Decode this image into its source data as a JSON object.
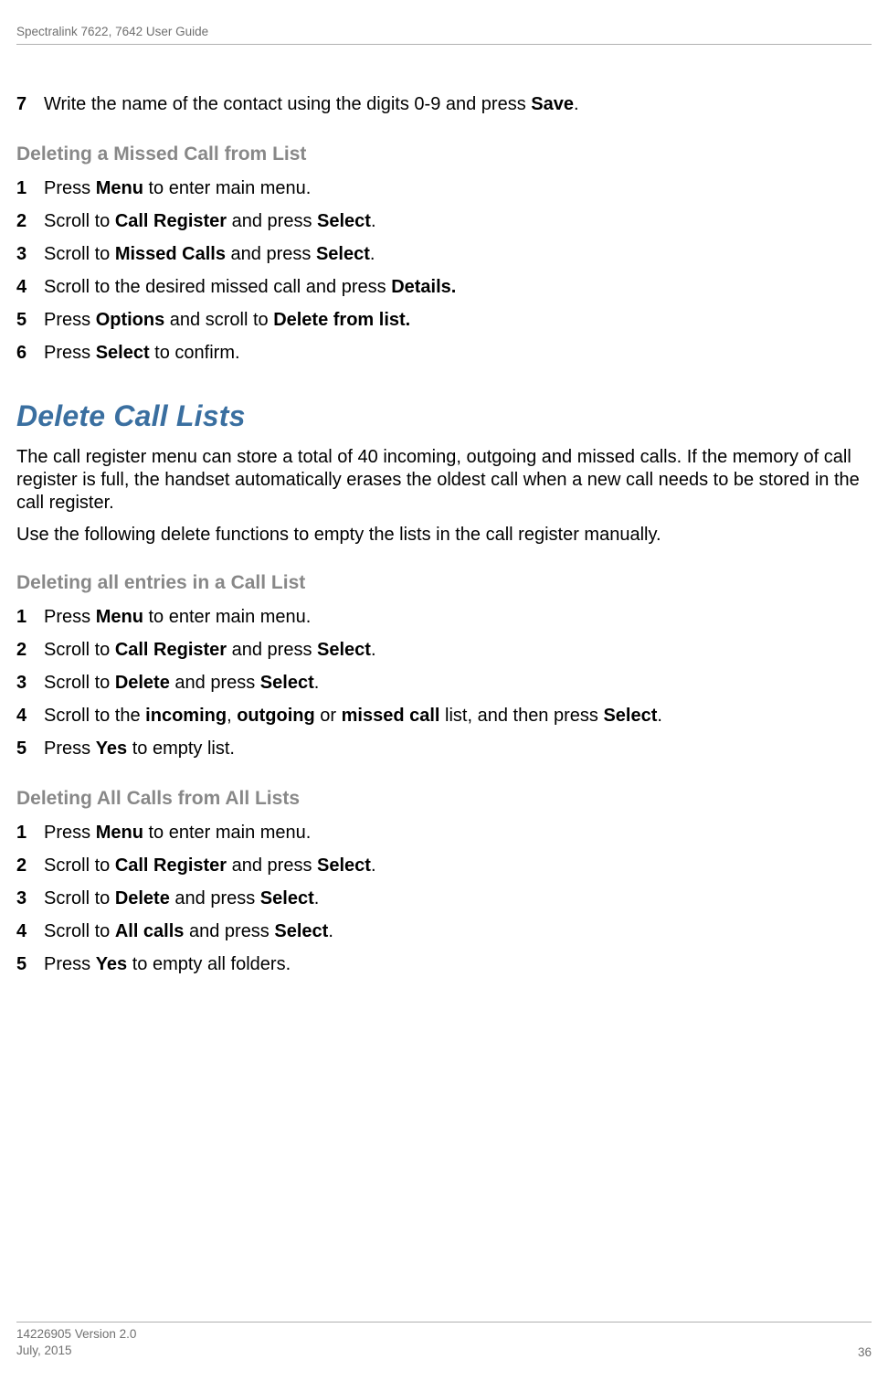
{
  "header": {
    "title": "Spectralink 7622, 7642 User Guide"
  },
  "intro_step": {
    "num": "7",
    "text_before": "Write the name of the contact using the digits 0-9 and press ",
    "bold1": "Save",
    "text_after": "."
  },
  "sub1": {
    "heading": "Deleting a Missed Call from List",
    "steps": [
      {
        "num": "1",
        "parts": [
          "Press ",
          "Menu",
          " to enter main menu."
        ]
      },
      {
        "num": "2",
        "parts": [
          "Scroll to ",
          "Call Register",
          " and press ",
          "Select",
          "."
        ]
      },
      {
        "num": "3",
        "parts": [
          "Scroll to ",
          "Missed Calls",
          " and press ",
          "Select",
          "."
        ]
      },
      {
        "num": "4",
        "parts": [
          "Scroll to the desired missed call and press ",
          "Details."
        ]
      },
      {
        "num": "5",
        "parts": [
          "Press ",
          "Options",
          " and scroll to ",
          "Delete from list."
        ]
      },
      {
        "num": "6",
        "parts": [
          "Press ",
          "Select",
          " to confirm."
        ]
      }
    ]
  },
  "section": {
    "heading": "Delete Call Lists",
    "para1": "The call register menu can store a total of 40 incoming, outgoing and missed calls. If the memory of call register is full, the handset automatically erases the oldest call when a new call needs to be stored in the call register.",
    "para2": "Use the following delete functions to empty the lists in the call register manually."
  },
  "sub2": {
    "heading": "Deleting all entries in a Call List",
    "steps": [
      {
        "num": "1",
        "parts": [
          "Press ",
          "Menu",
          " to enter main menu."
        ]
      },
      {
        "num": "2",
        "parts": [
          "Scroll to ",
          "Call Register",
          " and press ",
          "Select",
          "."
        ]
      },
      {
        "num": "3",
        "parts": [
          "Scroll to ",
          "Delete",
          " and press ",
          "Select",
          "."
        ]
      },
      {
        "num": "4",
        "parts": [
          "Scroll to the ",
          "incoming",
          ", ",
          "outgoing",
          " or ",
          "missed call",
          " list, and then press ",
          "Select",
          "."
        ]
      },
      {
        "num": "5",
        "parts": [
          "Press ",
          "Yes",
          " to empty list."
        ]
      }
    ]
  },
  "sub3": {
    "heading": "Deleting All Calls from All Lists",
    "steps": [
      {
        "num": "1",
        "parts": [
          "Press ",
          "Menu",
          " to enter main menu."
        ]
      },
      {
        "num": "2",
        "parts": [
          "Scroll to ",
          "Call Register",
          " and press ",
          "Select",
          "."
        ]
      },
      {
        "num": "3",
        "parts": [
          "Scroll to ",
          "Delete",
          " and press ",
          "Select",
          "."
        ]
      },
      {
        "num": "4",
        "parts": [
          "Scroll to ",
          "All calls",
          " and press ",
          "Select",
          "."
        ]
      },
      {
        "num": "5",
        "parts": [
          "Press ",
          "Yes",
          " to empty all folders."
        ]
      }
    ]
  },
  "footer": {
    "line1": "14226905 Version 2.0",
    "line2": "July, 2015",
    "page": "36"
  }
}
